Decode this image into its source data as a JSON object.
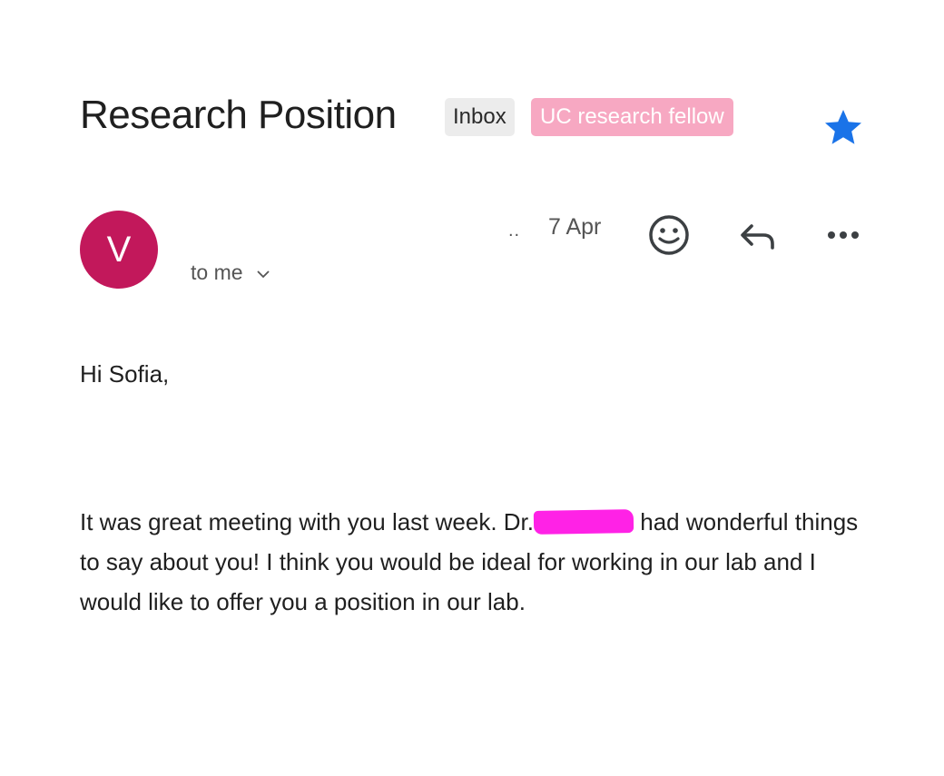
{
  "email": {
    "subject": "Research Position",
    "labels": {
      "inbox": "Inbox",
      "custom": "UC research fellow"
    },
    "starred": true,
    "sender": {
      "avatar_letter": "V",
      "avatar_color": "#c2185b"
    },
    "recipient": "to me",
    "truncation_marker": "..",
    "date": "7 Apr",
    "body": {
      "greeting": "Hi Sofia,",
      "paragraph_before": "It was great meeting with you last week. Dr.",
      "paragraph_after": "had wonderful things to say about you!  I think you would be ideal for working in our lab and I would like to offer you a position in our lab."
    }
  },
  "icons": {
    "star": "star-icon",
    "chevron": "chevron-down-icon",
    "emoji": "smiley-icon",
    "reply": "reply-icon",
    "more": "more-horizontal-icon"
  },
  "colors": {
    "star": "#1a73e8",
    "label_fellow_bg": "#f7a8c2",
    "label_inbox_bg": "#ececec",
    "redaction": "#ff22e6"
  }
}
